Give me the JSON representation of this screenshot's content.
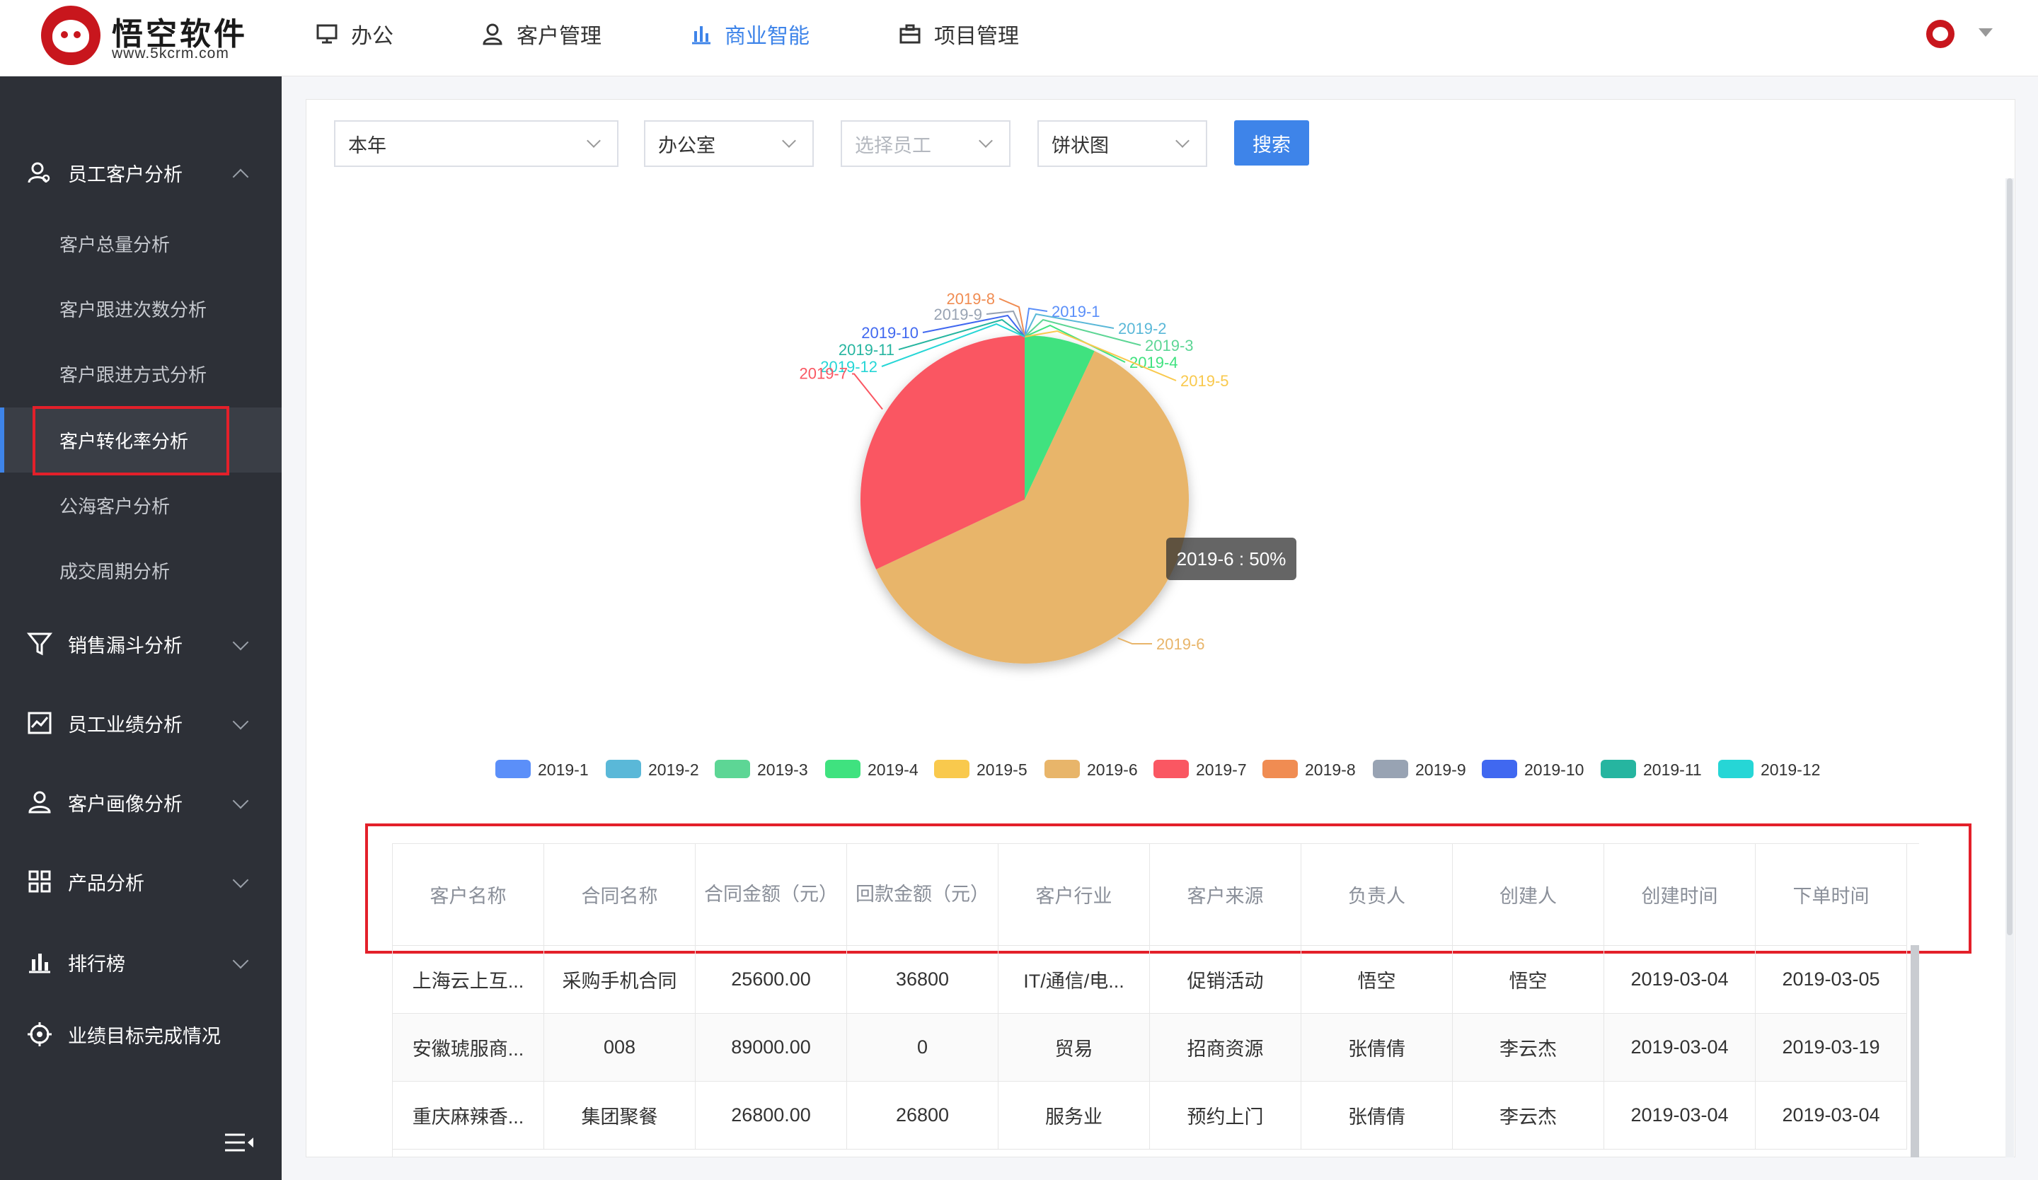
{
  "app": {
    "logo_name": "悟空软件",
    "logo_url": "www.5kcrm.com"
  },
  "nav": [
    {
      "label": "办公",
      "icon": "monitor-icon"
    },
    {
      "label": "客户管理",
      "icon": "user-icon"
    },
    {
      "label": "商业智能",
      "icon": "bar-chart-icon",
      "active": true
    },
    {
      "label": "项目管理",
      "icon": "briefcase-icon"
    }
  ],
  "sidebar": {
    "groups": [
      {
        "label": "员工客户分析",
        "icon": "user-search-icon",
        "expanded": true
      },
      {
        "label": "销售漏斗分析",
        "icon": "funnel-icon"
      },
      {
        "label": "员工业绩分析",
        "icon": "line-chart-icon"
      },
      {
        "label": "客户画像分析",
        "icon": "user-icon"
      },
      {
        "label": "产品分析",
        "icon": "grid-icon"
      },
      {
        "label": "排行榜",
        "icon": "bar-chart-icon"
      },
      {
        "label": "业绩目标完成情况",
        "icon": "target-icon"
      }
    ],
    "sub_items": [
      {
        "label": "客户总量分析"
      },
      {
        "label": "客户跟进次数分析"
      },
      {
        "label": "客户跟进方式分析"
      },
      {
        "label": "客户转化率分析",
        "active": true
      },
      {
        "label": "公海客户分析"
      },
      {
        "label": "成交周期分析"
      }
    ]
  },
  "filters": {
    "period": "本年",
    "department": "办公室",
    "employee_placeholder": "选择员工",
    "chart_type": "饼状图",
    "search_label": "搜索"
  },
  "tooltip": "2019-6 : 50%",
  "colors": {
    "accent": "#3e84e9",
    "highlight_box": "#e3202a",
    "sidebar_bg": "#2d3037"
  },
  "chart_data": {
    "type": "pie",
    "categories": [
      "2019-1",
      "2019-2",
      "2019-3",
      "2019-4",
      "2019-5",
      "2019-6",
      "2019-7",
      "2019-8",
      "2019-9",
      "2019-10",
      "2019-11",
      "2019-12"
    ],
    "values": [
      0,
      0,
      0,
      7,
      0,
      61,
      32,
      0,
      0,
      0,
      0,
      0
    ],
    "colors": [
      "#5b8ff9",
      "#5ab8d8",
      "#5dd695",
      "#3fe27f",
      "#f9c94d",
      "#e8b56a",
      "#fa5762",
      "#f08c52",
      "#98a3b3",
      "#4068f0",
      "#26b5a0",
      "#26d6d6"
    ],
    "legend_position": "bottom",
    "labels": [
      "2019-1",
      "2019-2",
      "2019-3",
      "2019-4",
      "2019-5",
      "2019-6",
      "2019-7",
      "2019-8",
      "2019-9",
      "2019-10",
      "2019-11",
      "2019-12"
    ]
  },
  "table": {
    "columns": [
      "客户名称",
      "合同名称",
      "合同金额（元）",
      "回款金额（元）",
      "客户行业",
      "客户来源",
      "负责人",
      "创建人",
      "创建时间",
      "下单时间"
    ],
    "rows": [
      [
        "上海云上互...",
        "采购手机合同",
        "25600.00",
        "36800",
        "IT/通信/电...",
        "促销活动",
        "悟空",
        "悟空",
        "2019-03-04",
        "2019-03-05"
      ],
      [
        "安徽琥服商...",
        "008",
        "89000.00",
        "0",
        "贸易",
        "招商资源",
        "张倩倩",
        "李云杰",
        "2019-03-04",
        "2019-03-19"
      ],
      [
        "重庆麻辣香...",
        "集团聚餐",
        "26800.00",
        "26800",
        "服务业",
        "预约上门",
        "张倩倩",
        "李云杰",
        "2019-03-04",
        "2019-03-04"
      ]
    ]
  }
}
